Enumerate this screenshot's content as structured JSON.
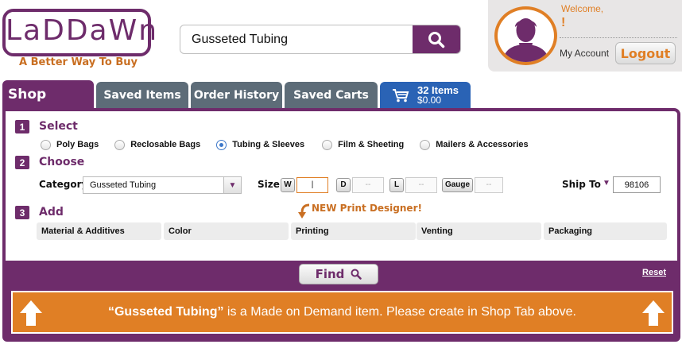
{
  "header": {
    "logo_text": "LaDDaWn",
    "tagline": "A Better Way To Buy",
    "search_value": "Gusseted Tubing"
  },
  "account": {
    "welcome": "Welcome,",
    "user_suffix": "!",
    "my_account": "My Account",
    "logout": "Logout"
  },
  "tabs": {
    "shop": "Shop",
    "saved_items": "Saved Items",
    "order_history": "Order History",
    "saved_carts": "Saved Carts",
    "cart_items": "32 Items",
    "cart_total": "$0.00"
  },
  "steps": {
    "select": {
      "num": "1",
      "title": "Select"
    },
    "choose": {
      "num": "2",
      "title": "Choose"
    },
    "add": {
      "num": "3",
      "title": "Add"
    }
  },
  "product_types": [
    {
      "label": "Poly Bags",
      "checked": false
    },
    {
      "label": "Reclosable Bags",
      "checked": false
    },
    {
      "label": "Tubing & Sleeves",
      "checked": true
    },
    {
      "label": "Film & Sheeting",
      "checked": false
    },
    {
      "label": "Mailers & Accessories",
      "checked": false
    }
  ],
  "choose": {
    "category_label": "Category",
    "category_value": "Gusseted Tubing",
    "size_label": "Size",
    "w_tag": "W",
    "w_value": "|",
    "d_tag": "D",
    "d_value": "--",
    "l_tag": "L",
    "l_value": "--",
    "gauge_tag": "Gauge",
    "gauge_value": "--",
    "ship_to_label": "Ship To",
    "ship_to_value": "98106"
  },
  "add": {
    "new_designer": "NEW Print Designer!",
    "columns": [
      "Material & Additives",
      "Color",
      "Printing",
      "Venting",
      "Packaging"
    ]
  },
  "actions": {
    "find": "Find",
    "reset": "Reset"
  },
  "notice": {
    "item": "“Gusseted Tubing”",
    "message": " is a Made on Demand item. Please create in Shop Tab above."
  },
  "colors": {
    "brand_purple": "#6e2c6b",
    "accent_orange": "#e07f25",
    "tab_gray": "#5d6c78",
    "cart_blue": "#2a63b5"
  }
}
